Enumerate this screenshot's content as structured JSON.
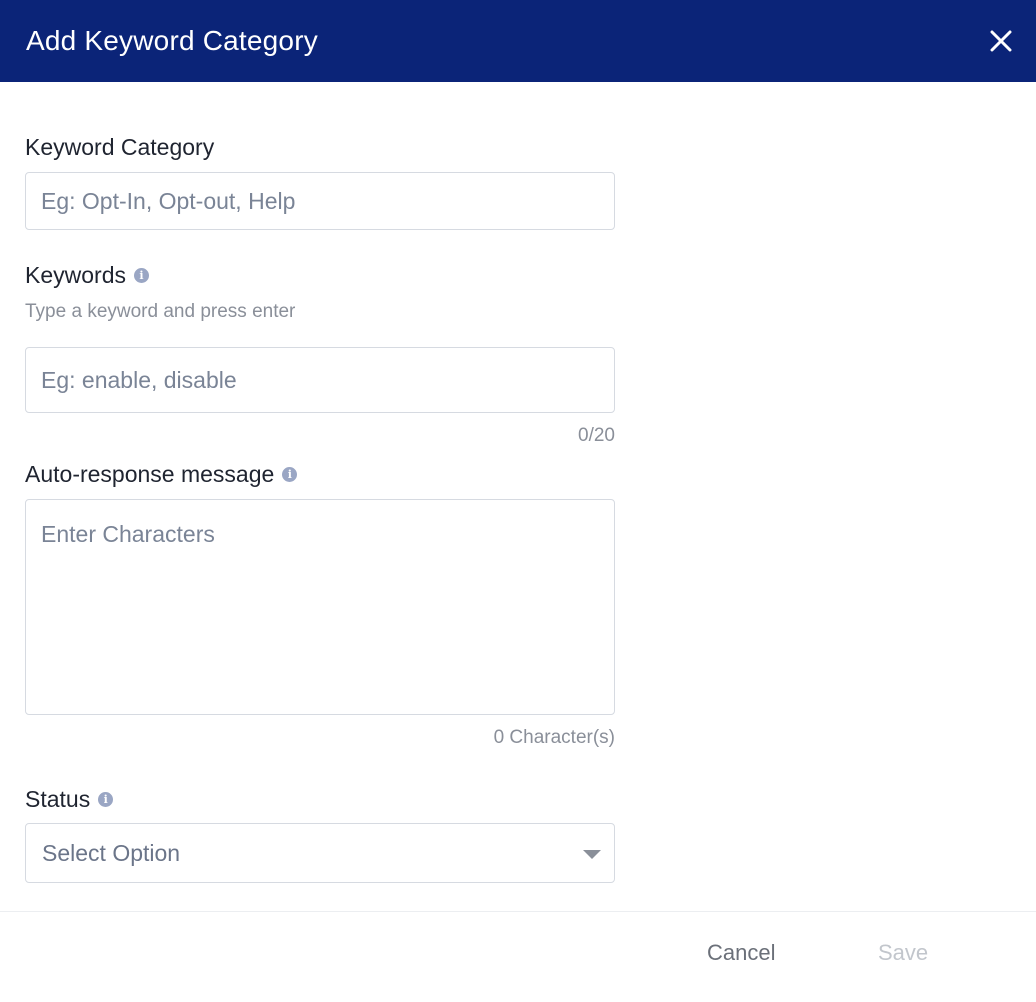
{
  "dialog": {
    "title": "Add Keyword Category",
    "close_icon": "close-icon"
  },
  "keyword_category": {
    "label": "Keyword Category",
    "value": "",
    "placeholder": "Eg: Opt-In, Opt-out, Help"
  },
  "keywords": {
    "label": "Keywords",
    "info_icon": "info-icon",
    "hint": "Type a keyword and press enter",
    "value": "",
    "placeholder": "Eg: enable, disable",
    "counter": "0/20"
  },
  "auto_response": {
    "label": "Auto-response message",
    "info_icon": "info-icon",
    "value": "",
    "placeholder": "Enter Characters",
    "counter": "0 Character(s)"
  },
  "status": {
    "label": "Status",
    "info_icon": "info-icon",
    "selected": "Select Option",
    "caret_icon": "caret-down-icon"
  },
  "footer": {
    "cancel_label": "Cancel",
    "save_label": "Save"
  },
  "colors": {
    "header_bg": "#0b2478",
    "save_disabled": "#c2c6cc"
  }
}
